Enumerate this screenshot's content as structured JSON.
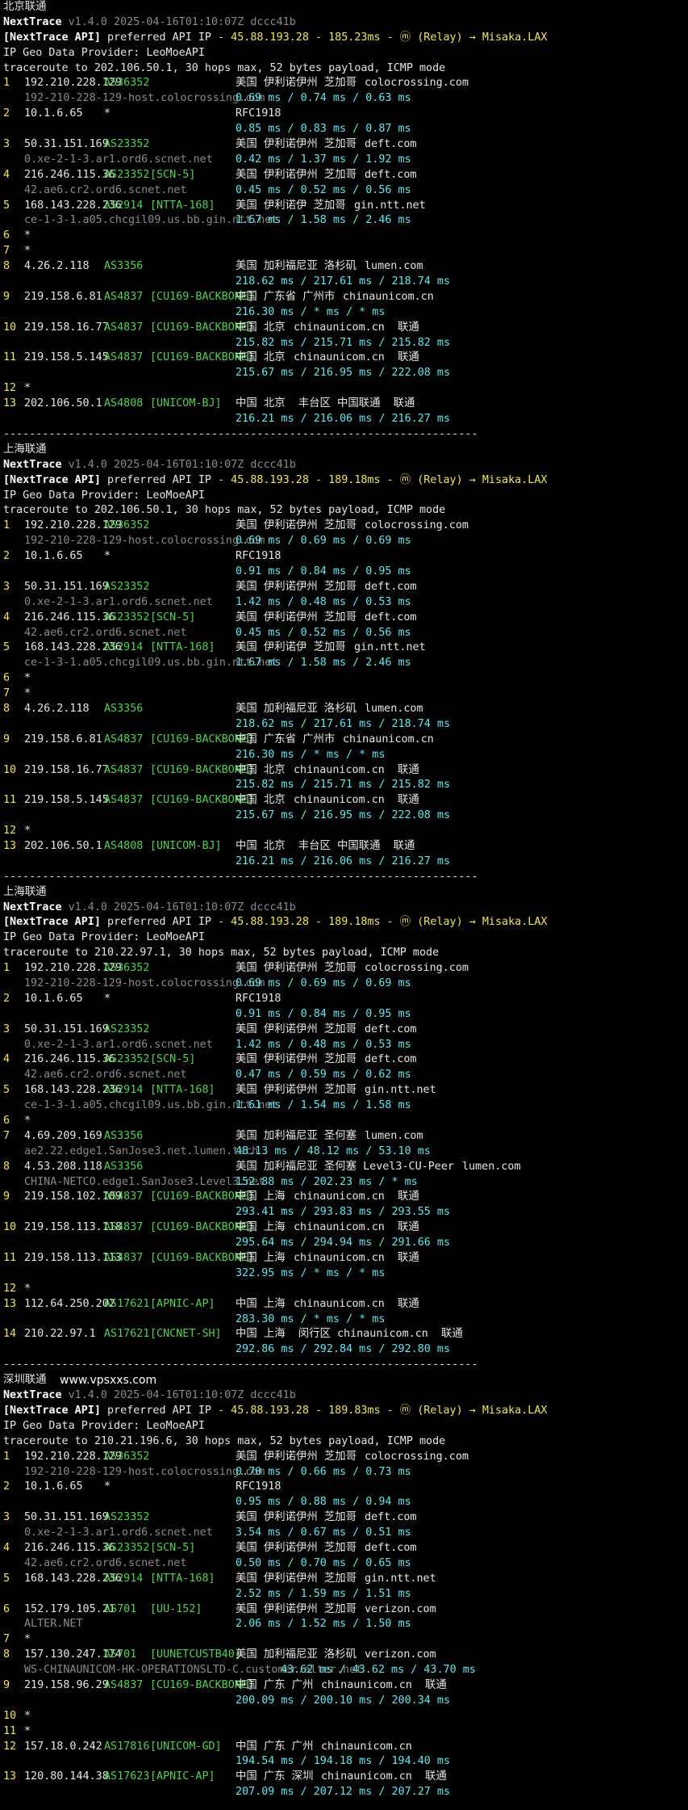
{
  "colors": {
    "background": "#000000",
    "text": "#e6e6e6",
    "gray": "#8a8a8a",
    "yellow": "#f2e35a",
    "green": "#4fd24f",
    "cyan": "#5fe8ee"
  },
  "sections": [
    {
      "title": "北京联通",
      "header": {
        "brand": "NextTrace",
        "version": "v1.4.0 2025-04-16T01:10:07Z dccc41b",
        "api_tag": "[NextTrace API]",
        "api_text": "preferred API IP",
        "api_info": "- 45.88.193.28 - 185.23ms - ⓜ (Relay) → Misaka.LAX"
      },
      "geo_provider": "IP Geo Data Provider: LeoMoeAPI",
      "traceroute": "traceroute to 202.106.50.1, 30 hops max, 52 bytes payload, ICMP mode",
      "hops": [
        {
          "n": "1",
          "ip": "192.210.228.129",
          "asn": "AS36352",
          "tag": "",
          "geo": "美国 伊利诺伊州 芝加哥",
          "domain": "colocrossing.com",
          "host": "192-210-228-129-host.colocrossing.com",
          "rtt": "0.69 ms / 0.74 ms / 0.63 ms"
        },
        {
          "n": "2",
          "ip": "10.1.6.65",
          "asn": "*",
          "tag": "",
          "geo": "RFC1918",
          "domain": "",
          "host": "",
          "rtt": "0.85 ms / 0.83 ms / 0.87 ms"
        },
        {
          "n": "3",
          "ip": "50.31.151.169",
          "asn": "AS23352",
          "tag": "",
          "geo": "美国 伊利诺伊州 芝加哥",
          "domain": "deft.com",
          "host": "0.xe-2-1-3.ar1.ord6.scnet.net",
          "rtt": "0.42 ms / 1.37 ms / 1.92 ms"
        },
        {
          "n": "4",
          "ip": "216.246.115.36",
          "asn": "AS23352",
          "tag": "[SCN-5]",
          "geo": "美国 伊利诺伊州 芝加哥",
          "domain": "deft.com",
          "host": "42.ae6.cr2.ord6.scnet.net",
          "rtt": "0.45 ms / 0.52 ms / 0.56 ms"
        },
        {
          "n": "5",
          "ip": "168.143.228.236",
          "asn": "AS2914",
          "tag": "[NTTA-168]",
          "geo": "美国 伊利诺伊 芝加哥",
          "domain": "gin.ntt.net",
          "host": "ce-1-3-1.a05.chcgil09.us.bb.gin.ntt.net",
          "rtt": "1.67 ms / 1.58 ms / 2.46 ms"
        },
        {
          "n": "6",
          "ip": "*"
        },
        {
          "n": "7",
          "ip": "*"
        },
        {
          "n": "8",
          "ip": "4.26.2.118",
          "asn": "AS3356",
          "tag": "",
          "geo": "美国 加利福尼亚 洛杉矶",
          "domain": "lumen.com",
          "host": "",
          "rtt": "218.62 ms / 217.61 ms / 218.74 ms"
        },
        {
          "n": "9",
          "ip": "219.158.6.81",
          "asn": "AS4837",
          "tag": "[CU169-BACKBONE]",
          "geo": "中国 广东省 广州市",
          "domain": "chinaunicom.cn",
          "host": "",
          "rtt": "216.30 ms / * ms / * ms"
        },
        {
          "n": "10",
          "ip": "219.158.16.77",
          "asn": "AS4837",
          "tag": "[CU169-BACKBONE]",
          "geo": "中国 北京",
          "domain": "chinaunicom.cn  联通",
          "host": "",
          "rtt": "215.82 ms / 215.71 ms / 215.82 ms"
        },
        {
          "n": "11",
          "ip": "219.158.5.145",
          "asn": "AS4837",
          "tag": "[CU169-BACKBONE]",
          "geo": "中国 北京",
          "domain": "chinaunicom.cn  联通",
          "host": "",
          "rtt": "215.67 ms / 216.95 ms / 222.08 ms"
        },
        {
          "n": "12",
          "ip": "*"
        },
        {
          "n": "13",
          "ip": "202.106.50.1",
          "asn": "AS4808",
          "tag": "[UNICOM-BJ]",
          "geo": "中国 北京  丰台区 中国联通  联通",
          "domain": "",
          "host": "",
          "rtt": "216.21 ms / 216.06 ms / 216.27 ms"
        }
      ]
    },
    {
      "title": "上海联通",
      "header": {
        "brand": "NextTrace",
        "version": "v1.4.0 2025-04-16T01:10:07Z dccc41b",
        "api_tag": "[NextTrace API]",
        "api_text": "preferred API IP",
        "api_info": "- 45.88.193.28 - 189.18ms - ⓜ (Relay) → Misaka.LAX"
      },
      "geo_provider": "IP Geo Data Provider: LeoMoeAPI",
      "traceroute": "traceroute to 202.106.50.1, 30 hops max, 52 bytes payload, ICMP mode",
      "hops": [
        {
          "n": "1",
          "ip": "192.210.228.129",
          "asn": "AS36352",
          "tag": "",
          "geo": "美国 伊利诺伊州 芝加哥",
          "domain": "colocrossing.com",
          "host": "192-210-228-129-host.colocrossing.com",
          "rtt": "0.69 ms / 0.69 ms / 0.69 ms"
        },
        {
          "n": "2",
          "ip": "10.1.6.65",
          "asn": "*",
          "tag": "",
          "geo": "RFC1918",
          "domain": "",
          "host": "",
          "rtt": "0.91 ms / 0.84 ms / 0.95 ms"
        },
        {
          "n": "3",
          "ip": "50.31.151.169",
          "asn": "AS23352",
          "tag": "",
          "geo": "美国 伊利诺伊州 芝加哥",
          "domain": "deft.com",
          "host": "0.xe-2-1-3.ar1.ord6.scnet.net",
          "rtt": "1.42 ms / 0.48 ms / 0.53 ms"
        },
        {
          "n": "4",
          "ip": "216.246.115.36",
          "asn": "AS23352",
          "tag": "[SCN-5]",
          "geo": "美国 伊利诺伊州 芝加哥",
          "domain": "deft.com",
          "host": "42.ae6.cr2.ord6.scnet.net",
          "rtt": "0.45 ms / 0.52 ms / 0.56 ms"
        },
        {
          "n": "5",
          "ip": "168.143.228.236",
          "asn": "AS2914",
          "tag": "[NTTA-168]",
          "geo": "美国 伊利诺伊 芝加哥",
          "domain": "gin.ntt.net",
          "host": "ce-1-3-1.a05.chcgil09.us.bb.gin.ntt.net",
          "rtt": "1.67 ms / 1.58 ms / 2.46 ms"
        },
        {
          "n": "6",
          "ip": "*"
        },
        {
          "n": "7",
          "ip": "*"
        },
        {
          "n": "8",
          "ip": "4.26.2.118",
          "asn": "AS3356",
          "tag": "",
          "geo": "美国 加利福尼亚 洛杉矶",
          "domain": "lumen.com",
          "host": "",
          "rtt": "218.62 ms / 217.61 ms / 218.74 ms"
        },
        {
          "n": "9",
          "ip": "219.158.6.81",
          "asn": "AS4837",
          "tag": "[CU169-BACKBONE]",
          "geo": "中国 广东省 广州市",
          "domain": "chinaunicom.cn",
          "host": "",
          "rtt": "216.30 ms / * ms / * ms"
        },
        {
          "n": "10",
          "ip": "219.158.16.77",
          "asn": "AS4837",
          "tag": "[CU169-BACKBONE]",
          "geo": "中国 北京",
          "domain": "chinaunicom.cn  联通",
          "host": "",
          "rtt": "215.82 ms / 215.71 ms / 215.82 ms"
        },
        {
          "n": "11",
          "ip": "219.158.5.145",
          "asn": "AS4837",
          "tag": "[CU169-BACKBONE]",
          "geo": "中国 北京",
          "domain": "chinaunicom.cn  联通",
          "host": "",
          "rtt": "215.67 ms / 216.95 ms / 222.08 ms"
        },
        {
          "n": "12",
          "ip": "*"
        },
        {
          "n": "13",
          "ip": "202.106.50.1",
          "asn": "AS4808",
          "tag": "[UNICOM-BJ]",
          "geo": "中国 北京  丰台区 中国联通  联通",
          "domain": "",
          "host": "",
          "rtt": "216.21 ms / 216.06 ms / 216.27 ms"
        }
      ]
    },
    {
      "title": "上海联通",
      "header": {
        "brand": "NextTrace",
        "version": "v1.4.0 2025-04-16T01:10:07Z dccc41b",
        "api_tag": "[NextTrace API]",
        "api_text": "preferred API IP",
        "api_info": "- 45.88.193.28 - 189.18ms - ⓜ (Relay) → Misaka.LAX"
      },
      "geo_provider": "IP Geo Data Provider: LeoMoeAPI",
      "traceroute": "traceroute to 210.22.97.1, 30 hops max, 52 bytes payload, ICMP mode",
      "hops": [
        {
          "n": "1",
          "ip": "192.210.228.129",
          "asn": "AS36352",
          "tag": "",
          "geo": "美国 伊利诺伊州 芝加哥",
          "domain": "colocrossing.com",
          "host": "192-210-228-129-host.colocrossing.com",
          "rtt": "0.69 ms / 0.69 ms / 0.69 ms"
        },
        {
          "n": "2",
          "ip": "10.1.6.65",
          "asn": "*",
          "tag": "",
          "geo": "RFC1918",
          "domain": "",
          "host": "",
          "rtt": "0.91 ms / 0.84 ms / 0.95 ms"
        },
        {
          "n": "3",
          "ip": "50.31.151.169",
          "asn": "AS23352",
          "tag": "",
          "geo": "美国 伊利诺伊州 芝加哥",
          "domain": "deft.com",
          "host": "0.xe-2-1-3.ar1.ord6.scnet.net",
          "rtt": "1.42 ms / 0.48 ms / 0.53 ms"
        },
        {
          "n": "4",
          "ip": "216.246.115.36",
          "asn": "AS23352",
          "tag": "[SCN-5]",
          "geo": "美国 伊利诺伊州 芝加哥",
          "domain": "deft.com",
          "host": "42.ae6.cr2.ord6.scnet.net",
          "rtt": "0.47 ms / 0.59 ms / 0.62 ms"
        },
        {
          "n": "5",
          "ip": "168.143.228.236",
          "asn": "AS2914",
          "tag": "[NTTA-168]",
          "geo": "美国 伊利诺伊州 芝加哥",
          "domain": "gin.ntt.net",
          "host": "ce-1-3-1.a05.chcgil09.us.bb.gin.ntt.net",
          "rtt": "1.61 ms / 1.54 ms / 1.58 ms"
        },
        {
          "n": "6",
          "ip": "*"
        },
        {
          "n": "7",
          "ip": "4.69.209.169",
          "asn": "AS3356",
          "tag": "",
          "geo": "美国 加利福尼亚 圣何塞",
          "domain": "lumen.com",
          "host": "ae2.22.edge1.SanJose3.net.lumen.tech",
          "rtt": "48.13 ms / 48.12 ms / 53.10 ms"
        },
        {
          "n": "8",
          "ip": "4.53.208.118",
          "asn": "AS3356",
          "tag": "",
          "geo": "美国 加利福尼亚 圣何塞 Level3-CU-Peer",
          "domain": "lumen.com",
          "host": "CHINA-NETCO.edge1.SanJose3.Level3.net",
          "rtt": "152.88 ms / 202.23 ms / * ms"
        },
        {
          "n": "9",
          "ip": "219.158.102.109",
          "asn": "AS4837",
          "tag": "[CU169-BACKBONE]",
          "geo": "中国 上海",
          "domain": "chinaunicom.cn  联通",
          "host": "",
          "rtt": "293.41 ms / 293.83 ms / 293.55 ms"
        },
        {
          "n": "10",
          "ip": "219.158.113.118",
          "asn": "AS4837",
          "tag": "[CU169-BACKBONE]",
          "geo": "中国 上海",
          "domain": "chinaunicom.cn  联通",
          "host": "",
          "rtt": "295.64 ms / 294.94 ms / 291.66 ms"
        },
        {
          "n": "11",
          "ip": "219.158.113.113",
          "asn": "AS4837",
          "tag": "[CU169-BACKBONE]",
          "geo": "中国 上海",
          "domain": "chinaunicom.cn  联通",
          "host": "",
          "rtt": "322.95 ms / * ms / * ms"
        },
        {
          "n": "12",
          "ip": "*"
        },
        {
          "n": "13",
          "ip": "112.64.250.202",
          "asn": "AS17621",
          "tag": "[APNIC-AP]",
          "geo": "中国 上海",
          "domain": "chinaunicom.cn  联通",
          "host": "",
          "rtt": "283.30 ms / * ms / * ms"
        },
        {
          "n": "14",
          "ip": "210.22.97.1",
          "asn": "AS17621",
          "tag": "[CNCNET-SH]",
          "geo": "中国 上海  闵行区 chinaunicom.cn  联通",
          "domain": "",
          "host": "",
          "rtt": "292.86 ms / 292.84 ms / 292.80 ms"
        }
      ]
    },
    {
      "title": "深圳联通",
      "watermark": "www.vpsxxs.com",
      "header": {
        "brand": "NextTrace",
        "version": "v1.4.0 2025-04-16T01:10:07Z dccc41b",
        "api_tag": "[NextTrace API]",
        "api_text": "preferred API IP",
        "api_info": "- 45.88.193.28 - 189.83ms - ⓜ (Relay) → Misaka.LAX"
      },
      "geo_provider": "IP Geo Data Provider: LeoMoeAPI",
      "traceroute": "traceroute to 210.21.196.6, 30 hops max, 52 bytes payload, ICMP mode",
      "hops": [
        {
          "n": "1",
          "ip": "192.210.228.129",
          "asn": "AS36352",
          "tag": "",
          "geo": "美国 伊利诺伊州 芝加哥",
          "domain": "colocrossing.com",
          "host": "192-210-228-129-host.colocrossing.com",
          "rtt": "0.70 ms / 0.66 ms / 0.73 ms"
        },
        {
          "n": "2",
          "ip": "10.1.6.65",
          "asn": "*",
          "tag": "",
          "geo": "RFC1918",
          "domain": "",
          "host": "",
          "rtt": "0.95 ms / 0.88 ms / 0.94 ms"
        },
        {
          "n": "3",
          "ip": "50.31.151.169",
          "asn": "AS23352",
          "tag": "",
          "geo": "美国 伊利诺伊州 芝加哥",
          "domain": "deft.com",
          "host": "0.xe-2-1-3.ar1.ord6.scnet.net",
          "rtt": "3.54 ms / 0.67 ms / 0.51 ms"
        },
        {
          "n": "4",
          "ip": "216.246.115.36",
          "asn": "AS23352",
          "tag": "[SCN-5]",
          "geo": "美国 伊利诺伊州 芝加哥",
          "domain": "deft.com",
          "host": "42.ae6.cr2.ord6.scnet.net",
          "rtt": "0.50 ms / 0.70 ms / 0.65 ms"
        },
        {
          "n": "5",
          "ip": "168.143.228.236",
          "asn": "AS2914",
          "tag": "[NTTA-168]",
          "geo": "美国 伊利诺伊州 芝加哥",
          "domain": "gin.ntt.net",
          "host": "",
          "rtt": "2.52 ms / 1.59 ms / 1.51 ms"
        },
        {
          "n": "6",
          "ip": "152.179.105.21",
          "asn": "AS701",
          "tag": "[UU-152]",
          "geo": "美国 伊利诺伊州 芝加哥",
          "domain": "verizon.com",
          "host": "ALTER.NET",
          "rtt": "2.06 ms / 1.52 ms / 1.50 ms",
          "rtt_inline": true
        },
        {
          "n": "7",
          "ip": "*"
        },
        {
          "n": "8",
          "ip": "157.130.247.174",
          "asn": "AS701",
          "tag": "[UUNETCUSTB40]",
          "geo": "美国 加利福尼亚 洛杉矶",
          "domain": "verizon.com",
          "host": "WS-CHINAUNICOM-HK-OPERATIONSLTD-C.customer.alter.net",
          "rtt": "43.62 ms / 43.62 ms / 43.70 ms",
          "rtt_inline": true
        },
        {
          "n": "9",
          "ip": "219.158.96.29",
          "asn": "AS4837",
          "tag": "[CU169-BACKBONE]",
          "geo": "中国 广东 广州",
          "domain": "chinaunicom.cn  联通",
          "host": "",
          "rtt": "200.09 ms / 200.10 ms / 200.34 ms"
        },
        {
          "n": "10",
          "ip": "*"
        },
        {
          "n": "11",
          "ip": "*"
        },
        {
          "n": "12",
          "ip": "157.18.0.242",
          "asn": "AS17816",
          "tag": "[UNICOM-GD]",
          "geo": "中国 广东 广州",
          "domain": "chinaunicom.cn",
          "host": "",
          "rtt": "194.54 ms / 194.18 ms / 194.40 ms"
        },
        {
          "n": "13",
          "ip": "120.80.144.38",
          "asn": "AS17623",
          "tag": "[APNIC-AP]",
          "geo": "中国 广东 深圳",
          "domain": "chinaunicom.cn  联通",
          "host": "",
          "rtt": "207.09 ms / 207.12 ms / 207.27 ms"
        }
      ]
    }
  ],
  "separator": "-------------------------------------------------------------------------"
}
